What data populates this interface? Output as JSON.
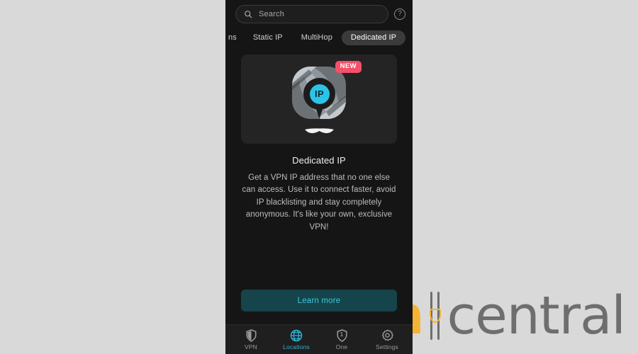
{
  "watermark": {
    "brand_first": "vpn",
    "brand_second": "central",
    "color_first": "#f5b335",
    "color_second": "#6e6e6e"
  },
  "search": {
    "placeholder": "Search",
    "icon": "search-icon",
    "help_icon": "help-circle-icon",
    "help_label": "?"
  },
  "tabs": [
    {
      "label": "ns",
      "active": false,
      "clipped": true
    },
    {
      "label": "Static IP",
      "active": false
    },
    {
      "label": "MultiHop",
      "active": false
    },
    {
      "label": "Dedicated IP",
      "active": true
    }
  ],
  "hero": {
    "badge": "NEW",
    "badge_color": "#f4506b",
    "pin_text": "IP",
    "pin_color": "#2bc4e8",
    "icon": "globe-location-pin-icon"
  },
  "info": {
    "title": "Dedicated IP",
    "description": "Get a VPN IP address that no one else can access. Use it to connect faster, avoid IP blacklisting and stay completely anonymous. It's like your own, exclusive VPN!"
  },
  "cta": {
    "label": "Learn more",
    "bg": "#15444b",
    "text_color": "#3fc8dd"
  },
  "bottom_nav": {
    "active_color": "#2bb4d8",
    "items": [
      {
        "label": "VPN",
        "icon": "shield-icon",
        "active": false
      },
      {
        "label": "Locations",
        "icon": "globe-icon",
        "active": true
      },
      {
        "label": "One",
        "icon": "shield-one-icon",
        "badge_number": "1",
        "active": false
      },
      {
        "label": "Settings",
        "icon": "gear-icon",
        "active": false
      }
    ]
  }
}
